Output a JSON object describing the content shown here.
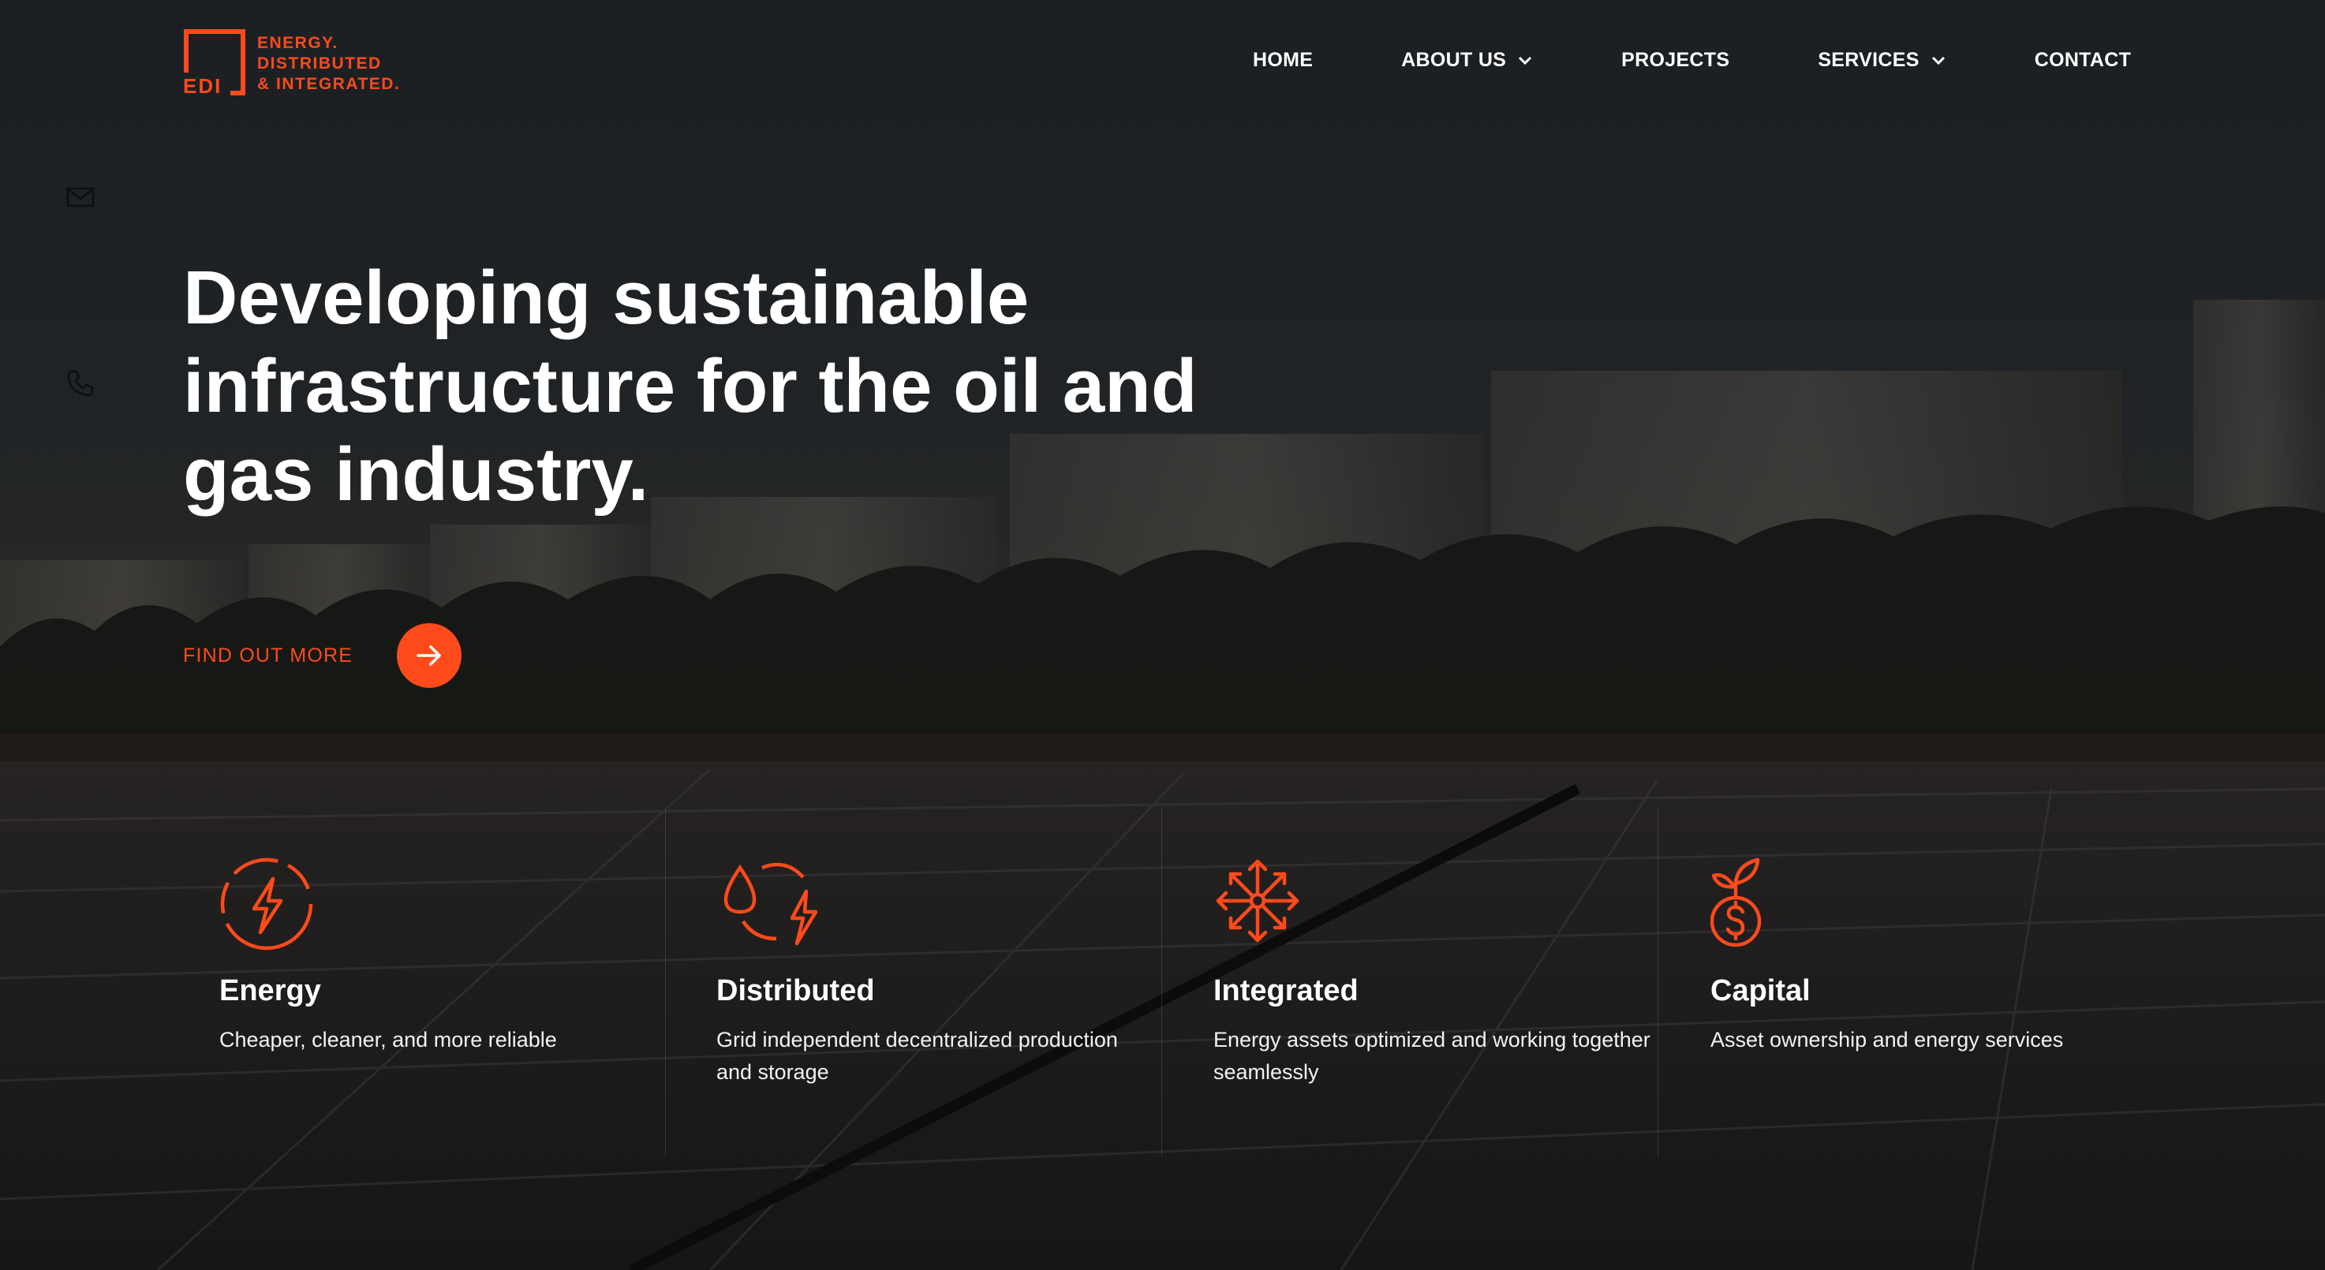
{
  "brand": {
    "abbr": "EDI",
    "lines": [
      "ENERGY.",
      "DISTRIBUTED",
      "& INTEGRATED."
    ],
    "accent": "#ff4a1c"
  },
  "nav": {
    "items": [
      {
        "label": "HOME",
        "dropdown": false
      },
      {
        "label": "ABOUT US",
        "dropdown": true
      },
      {
        "label": "PROJECTS",
        "dropdown": false
      },
      {
        "label": "SERVICES",
        "dropdown": true
      },
      {
        "label": "CONTACT",
        "dropdown": false
      }
    ]
  },
  "side": {
    "icons": [
      "mail-icon",
      "phone-icon"
    ]
  },
  "hero": {
    "title": "Developing sustainable infrastructure for the oil and gas industry.",
    "cta_label": "FIND OUT MORE",
    "cta_icon": "arrow-right-icon"
  },
  "features": [
    {
      "icon": "lightning-circle-icon",
      "title": "Energy",
      "text": "Cheaper, cleaner, and more reliable"
    },
    {
      "icon": "droplet-cycle-icon",
      "title": "Distributed",
      "text": "Grid independent decentralized production and storage"
    },
    {
      "icon": "network-arrows-icon",
      "title": "Integrated",
      "text": "Energy assets optimized and working together seamlessly"
    },
    {
      "icon": "sprout-dollar-icon",
      "title": "Capital",
      "text": "Asset ownership and energy services"
    }
  ]
}
